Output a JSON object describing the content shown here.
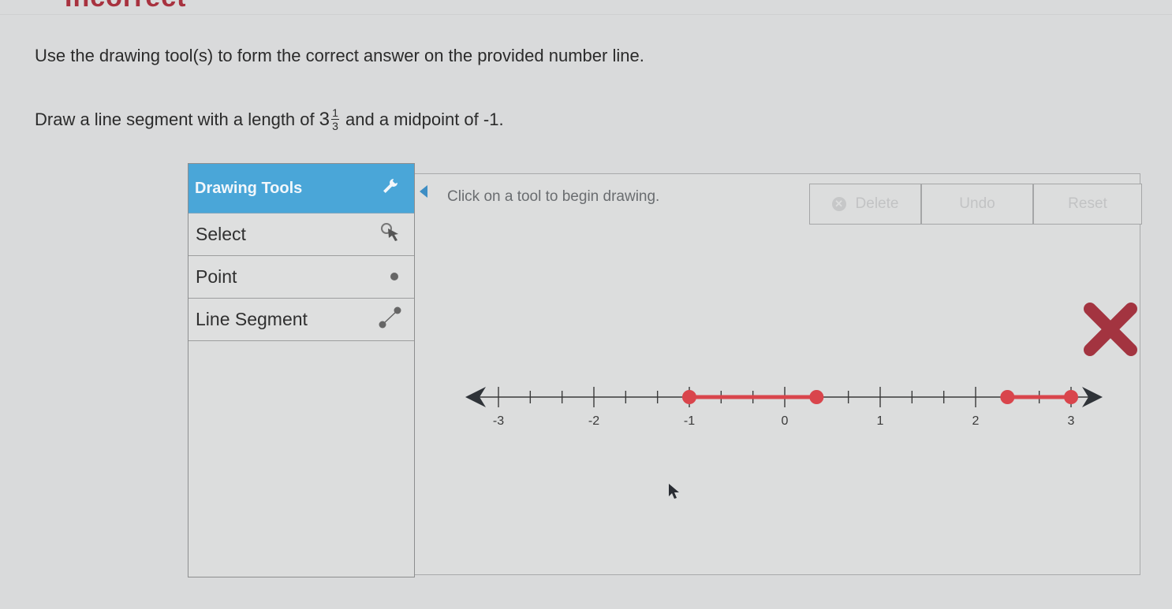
{
  "status": {
    "heading": "Incorrect",
    "color": "#a8323f"
  },
  "instruction": "Use the drawing tool(s) to form the correct answer on the provided number line.",
  "question": {
    "prefix": "Draw a line segment with a length of",
    "whole": "3",
    "numerator": "1",
    "denominator": "3",
    "suffix": "and a midpoint of -1."
  },
  "tools": {
    "title": "Drawing Tools",
    "title_icon": "wrench-icon",
    "accent": "#4aa6d8",
    "items": [
      {
        "label": "Select",
        "icon": "select-cursor-icon"
      },
      {
        "label": "Point",
        "icon": "point-icon"
      },
      {
        "label": "Line Segment",
        "icon": "line-segment-icon"
      }
    ]
  },
  "toolbar": {
    "hint": "Click on a tool to begin drawing.",
    "delete_label": "Delete",
    "undo_label": "Undo",
    "reset_label": "Reset"
  },
  "number_line": {
    "min": -3,
    "max": 3,
    "tick_step": 0.3333,
    "labels": [
      "-3",
      "-2",
      "-1",
      "0",
      "1",
      "2",
      "3"
    ],
    "segment_color": "#d9454c",
    "segments": [
      {
        "from": -1,
        "to": 0.3333
      },
      {
        "from": 2.3333,
        "to": 3
      }
    ]
  },
  "feedback": {
    "result": "incorrect",
    "mark_color": "#a33440"
  }
}
